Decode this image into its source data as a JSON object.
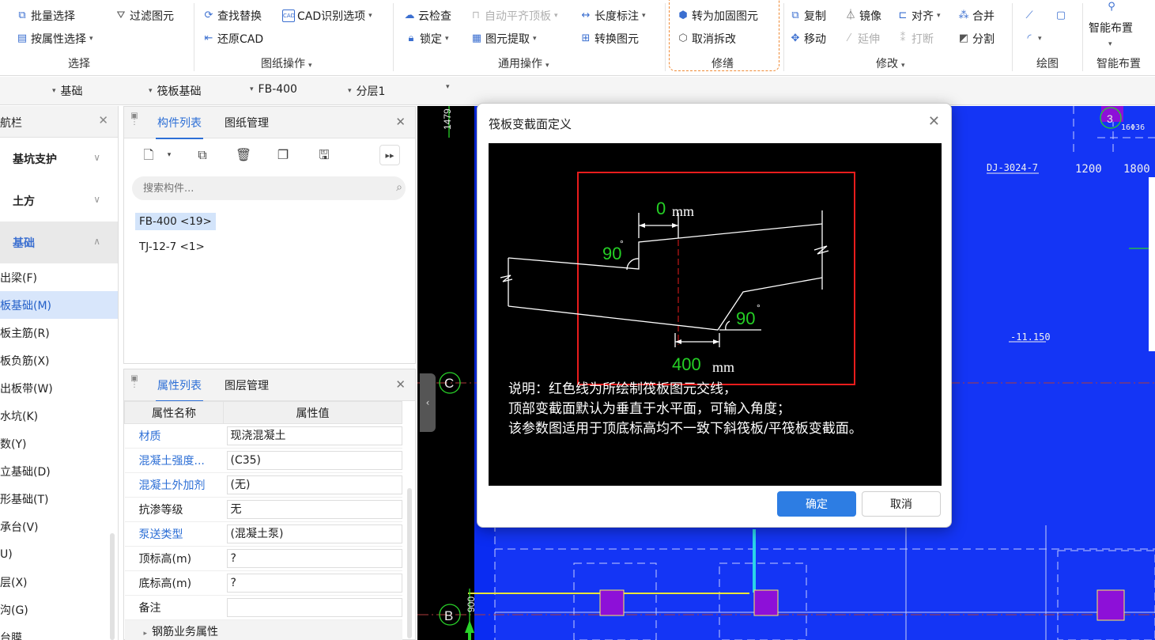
{
  "ribbon": {
    "select": {
      "batch": "批量选择",
      "by_attr": "按属性选择",
      "filter": "过滤图元",
      "group": "选择"
    },
    "drawing_ops": {
      "find_replace": "查找替换",
      "cad_recognize": "CAD识别选项",
      "restore_cad": "还原CAD",
      "group": "图纸操作"
    },
    "general_ops": {
      "cloud_check": "云检查",
      "auto_flat_top": "自动平齐顶板",
      "length_dim": "长度标注",
      "lock": "锁定",
      "extract": "图元提取",
      "convert": "转换图元",
      "group": "通用操作"
    },
    "repair": {
      "to_reinforce": "转为加固图元",
      "cancel_demolish": "取消拆改",
      "group": "修缮"
    },
    "modify": {
      "copy": "复制",
      "mirror": "镜像",
      "align": "对齐",
      "merge": "合并",
      "move": "移动",
      "extend": "延伸",
      "break": "打断",
      "split": "分割",
      "group": "修改"
    },
    "draw": {
      "group": "绘图"
    },
    "smart": {
      "label": "智能布置",
      "group": "智能布置"
    }
  },
  "toolbar2": {
    "category": "基础",
    "type": "筏板基础",
    "component": "FB-400",
    "layer": "分层1"
  },
  "nav": {
    "title": "航栏",
    "categories": [
      {
        "label": "基坑支护",
        "chev": "∨"
      },
      {
        "label": "土方",
        "chev": "∨"
      },
      {
        "label": "基础",
        "chev": "∧"
      }
    ],
    "items": [
      "出梁(F)",
      "板基础(M)",
      "板主筋(R)",
      "板负筋(X)",
      "出板带(W)",
      "水坑(K)",
      "数(Y)",
      "立基础(D)",
      "形基础(T)",
      "承台(V)",
      "U)",
      "层(X)",
      "沟(G)",
      "台膜"
    ]
  },
  "component_panel": {
    "tab_list": "构件列表",
    "tab_drawings": "图纸管理",
    "search_placeholder": "搜索构件...",
    "items": [
      "FB-400 <19>",
      "TJ-12-7 <1>"
    ]
  },
  "property_panel": {
    "tab_props": "属性列表",
    "tab_layers": "图层管理",
    "col_name": "属性名称",
    "col_value": "属性值",
    "rows": [
      {
        "name": "材质",
        "value": "现浇混凝土"
      },
      {
        "name": "混凝土强度...",
        "value": "(C35)"
      },
      {
        "name": "混凝土外加剂",
        "value": "(无)"
      },
      {
        "name": "抗渗等级",
        "value": "无"
      },
      {
        "name": "泵送类型",
        "value": "(混凝土泵)"
      },
      {
        "name": "顶标高(m)",
        "value": "?"
      },
      {
        "name": "底标高(m)",
        "value": "?"
      },
      {
        "name": "备注",
        "value": ""
      }
    ],
    "rebar_section": "钢筋业务属性"
  },
  "canvas": {
    "label_c": "C",
    "label_b": "B",
    "dim_top": "1479",
    "dj_label": "DJ-3024-7",
    "dim_1200": "1200",
    "dim_1800": "1800",
    "elev": "-11.150",
    "axis3": "3",
    "code": "16Φ36",
    "dim_b": "900"
  },
  "dialog": {
    "title": "筏板变截面定义",
    "top_offset": "0",
    "top_unit": "mm",
    "angle_top": "90",
    "angle_bottom": "90",
    "degree": "°",
    "bottom_offset": "400",
    "bottom_unit": "mm",
    "desc": [
      "说明：红色线为所绘制筏板图元交线，",
      "顶部变截面默认为垂直于水平面，可输入角度；",
      "该参数图适用于顶底标高均不一致下斜筏板/平筏板变截面。"
    ],
    "ok": "确定",
    "cancel": "取消"
  }
}
